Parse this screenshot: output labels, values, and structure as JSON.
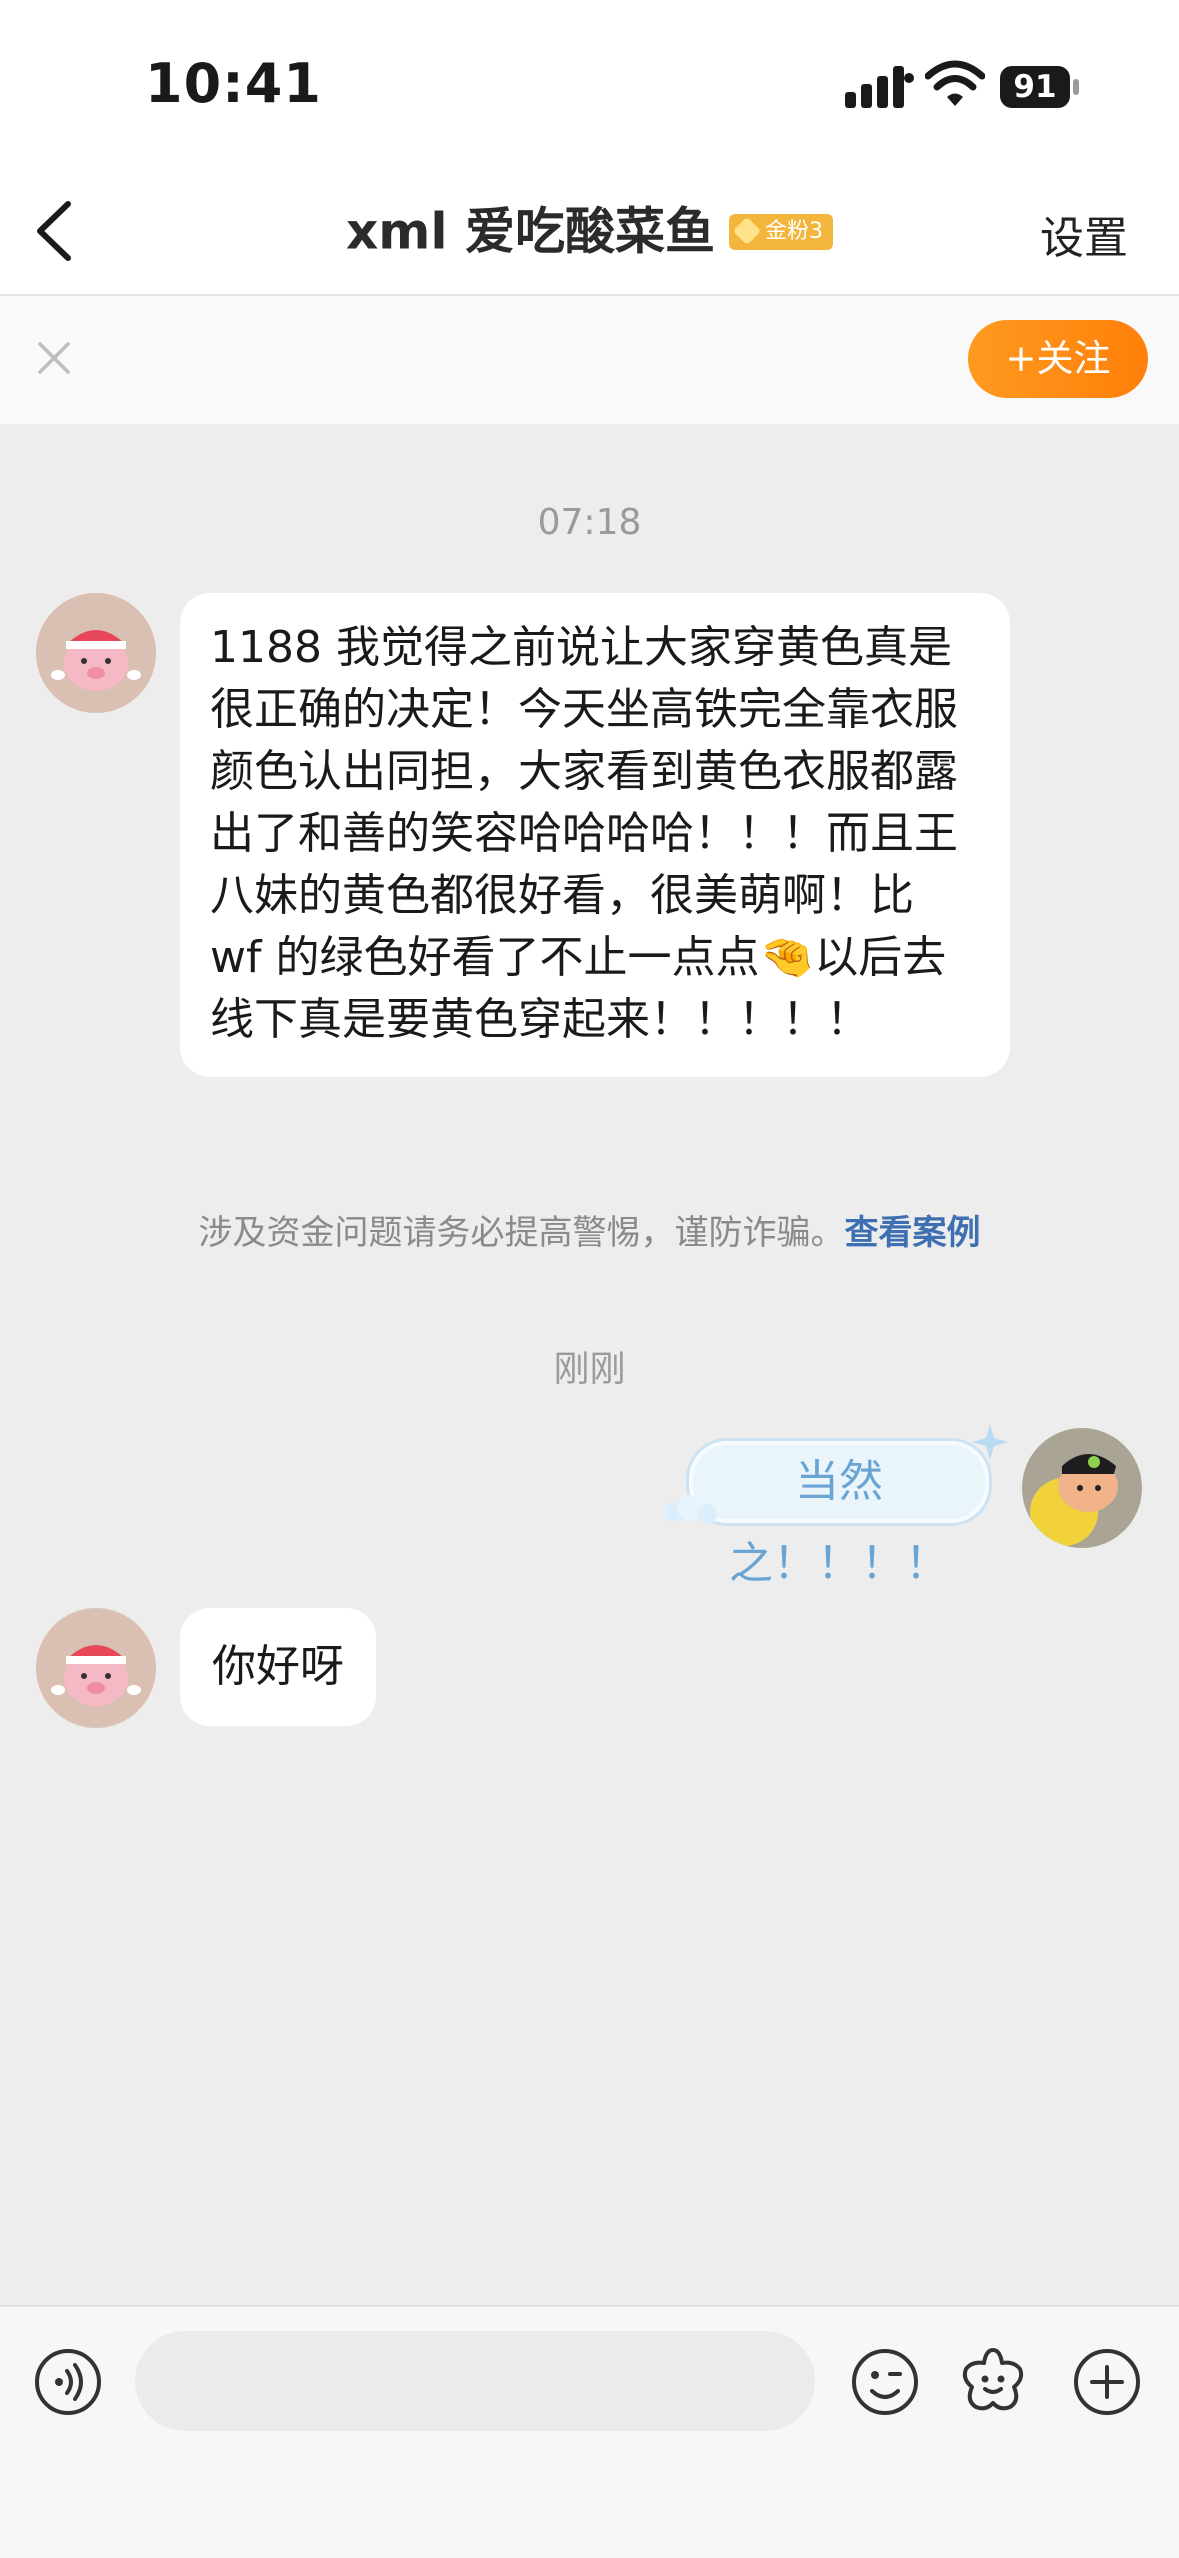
{
  "status_bar": {
    "time": "10:41",
    "battery": "91"
  },
  "nav": {
    "title": "xml 爱吃酸菜鱼",
    "fan_badge": "金粉3",
    "settings_label": "设置"
  },
  "follow_bar": {
    "follow_label": "+关注"
  },
  "chat": {
    "timestamp_1": "07:18",
    "message_1": "1188 我觉得之前说让大家穿黄色真是很正确的决定！今天坐高铁完全靠衣服颜色认出同担，大家看到黄色衣服都露出了和善的笑容哈哈哈哈！！！而且王八妹的黄色都很好看，很美萌啊！比 wf 的绿色好看了不止一点点🤏以后去线下真是要黄色穿起来！！！！！",
    "notice_text": "涉及资金问题请务必提高警惕，谨防诈骗。",
    "notice_link": "查看案例",
    "timestamp_2": "刚刚",
    "sent_message": "当然之！！！！",
    "message_2": "你好呀"
  },
  "input_bar": {
    "placeholder": ""
  },
  "colors": {
    "accent": "#ff8a14",
    "link": "#3e6fb0",
    "badge": "#f4b53c"
  },
  "icons": {
    "back": "chevron-left-icon",
    "close": "close-icon",
    "voice": "voice-icon",
    "emoji": "emoji-icon",
    "sticker": "sticker-icon",
    "more": "plus-icon"
  }
}
